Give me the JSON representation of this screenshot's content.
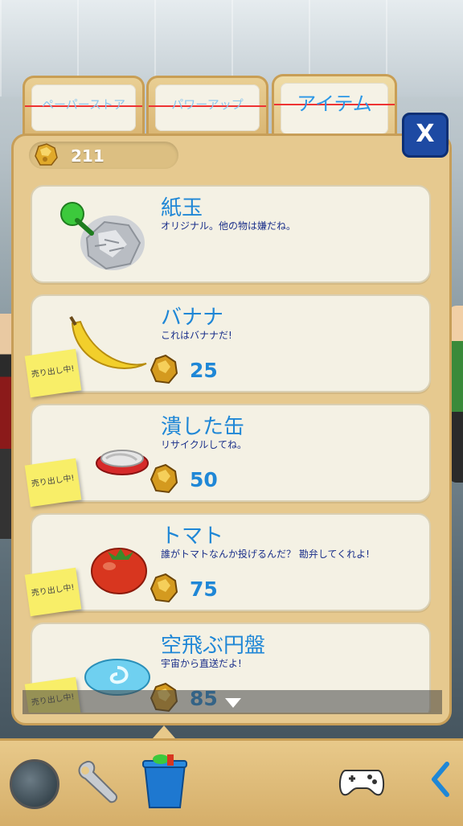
{
  "tabs": [
    {
      "label": "ペーパーストア",
      "active": false
    },
    {
      "label": "パワーアップ",
      "active": false
    },
    {
      "label": "アイテム",
      "active": true
    }
  ],
  "close_label": "X",
  "coins": {
    "count": "211"
  },
  "items": [
    {
      "title": "紙玉",
      "description": "オリジナル。他の物は嫌だね。",
      "price": "",
      "sale_note": "",
      "icon": "paper-ball-icon",
      "equipped": true
    },
    {
      "title": "バナナ",
      "description": "これはバナナだ!",
      "price": "25",
      "sale_note": "売り出し中!",
      "icon": "banana-icon"
    },
    {
      "title": "潰した缶",
      "description": "リサイクルしてね。",
      "price": "50",
      "sale_note": "売り出し中!",
      "icon": "crushed-can-icon"
    },
    {
      "title": "トマト",
      "description": "誰がトマトなんか投げるんだ？ 勘弁してくれよ!",
      "price": "75",
      "sale_note": "売り出し中!",
      "icon": "tomato-icon"
    },
    {
      "title": "空飛ぶ円盤",
      "description": "宇宙から直送だよ!",
      "price": "85",
      "sale_note": "売り出し中!",
      "icon": "flying-disc-icon"
    }
  ],
  "colors": {
    "accent": "#1f87d6",
    "panel": "#e6c98f",
    "close": "#1d4aa3"
  }
}
